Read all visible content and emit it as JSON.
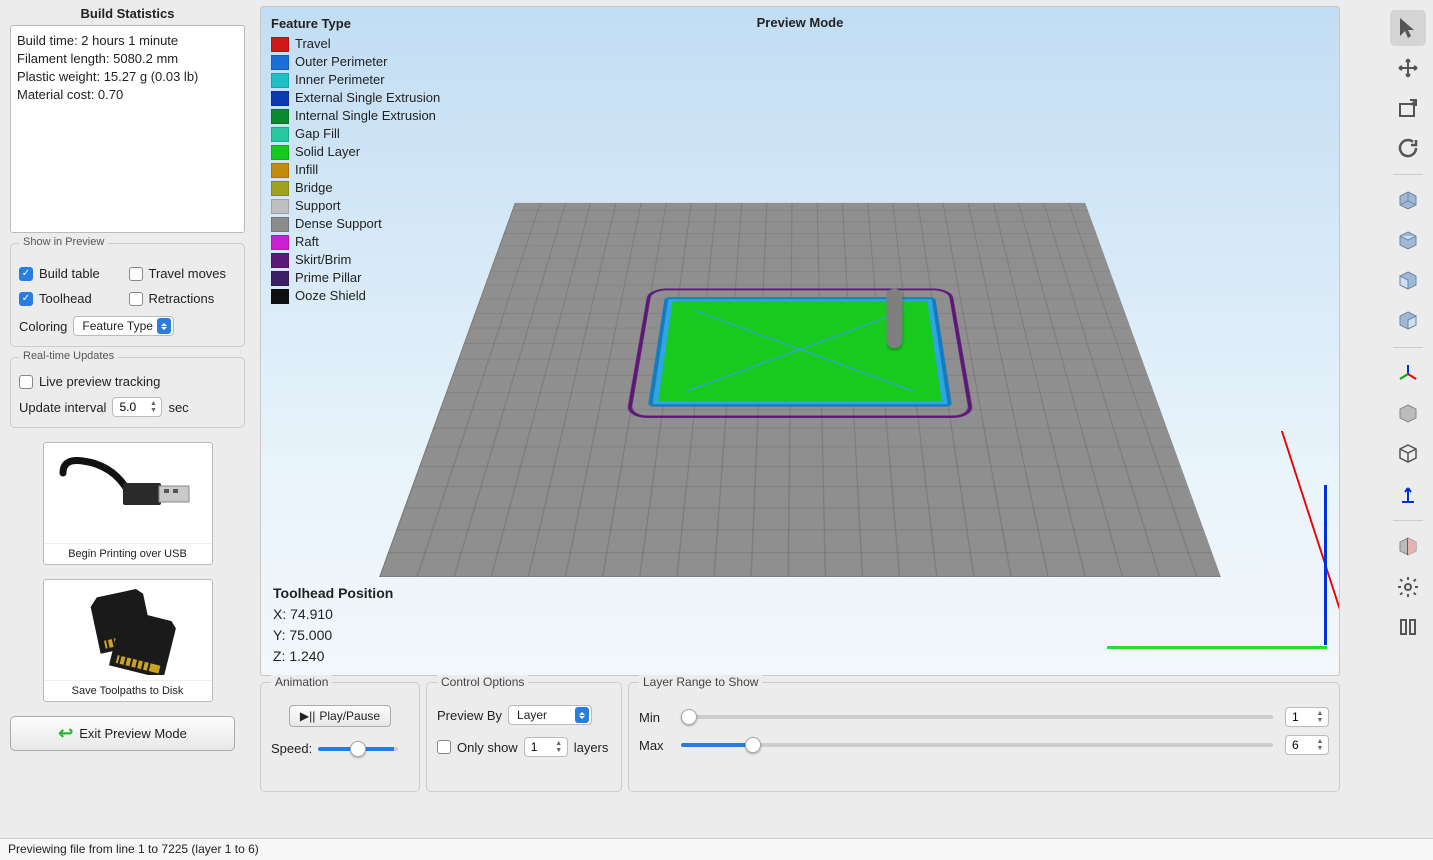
{
  "left": {
    "stats_title": "Build Statistics",
    "stats": {
      "build_time": "Build time: 2 hours 1 minute",
      "filament": "Filament length: 5080.2 mm",
      "weight": "Plastic weight: 15.27 g (0.03 lb)",
      "cost": "Material cost: 0.70"
    },
    "show_in_preview": {
      "title": "Show in Preview",
      "build_table": {
        "label": "Build table",
        "checked": true
      },
      "travel_moves": {
        "label": "Travel moves",
        "checked": false
      },
      "toolhead": {
        "label": "Toolhead",
        "checked": true
      },
      "retractions": {
        "label": "Retractions",
        "checked": false
      },
      "coloring_label": "Coloring",
      "coloring_value": "Feature Type"
    },
    "realtime": {
      "title": "Real-time Updates",
      "live_tracking": {
        "label": "Live preview tracking",
        "checked": false
      },
      "interval_label": "Update interval",
      "interval_value": "5.0",
      "interval_unit": "sec"
    },
    "usb_caption": "Begin Printing over USB",
    "disk_caption": "Save Toolpaths to Disk",
    "exit_btn": "Exit Preview Mode"
  },
  "viewport": {
    "mode_title": "Preview Mode",
    "legend_title": "Feature Type",
    "legend": [
      {
        "label": "Travel",
        "color": "#d01818"
      },
      {
        "label": "Outer Perimeter",
        "color": "#1a6fd6"
      },
      {
        "label": "Inner Perimeter",
        "color": "#1fbfc6"
      },
      {
        "label": "External Single Extrusion",
        "color": "#0d3ab3"
      },
      {
        "label": "Internal Single Extrusion",
        "color": "#0a8a2c"
      },
      {
        "label": "Gap Fill",
        "color": "#27c7a0"
      },
      {
        "label": "Solid Layer",
        "color": "#18c91e"
      },
      {
        "label": "Infill",
        "color": "#c38a10"
      },
      {
        "label": "Bridge",
        "color": "#9da31c"
      },
      {
        "label": "Support",
        "color": "#bfbfbf"
      },
      {
        "label": "Dense Support",
        "color": "#8c8c8c"
      },
      {
        "label": "Raft",
        "color": "#cc1fcf"
      },
      {
        "label": "Skirt/Brim",
        "color": "#5d1777"
      },
      {
        "label": "Prime Pillar",
        "color": "#3c1f66"
      },
      {
        "label": "Ooze Shield",
        "color": "#101010"
      }
    ],
    "toolhead_title": "Toolhead Position",
    "toolhead": {
      "x": "X: 74.910",
      "y": "Y: 75.000",
      "z": "Z: 1.240"
    }
  },
  "bottom": {
    "animation": {
      "title": "Animation",
      "play_pause": "Play/Pause",
      "speed_label": "Speed:"
    },
    "control": {
      "title": "Control Options",
      "preview_by_label": "Preview By",
      "preview_by_value": "Layer",
      "only_show_label": "Only show",
      "only_show_value": "1",
      "only_show_suffix": "layers"
    },
    "layer_range": {
      "title": "Layer Range to Show",
      "min_label": "Min",
      "min_value": "1",
      "max_label": "Max",
      "max_value": "6"
    }
  },
  "status_bar": "Previewing file from line 1 to 7225 (layer 1 to 6)"
}
